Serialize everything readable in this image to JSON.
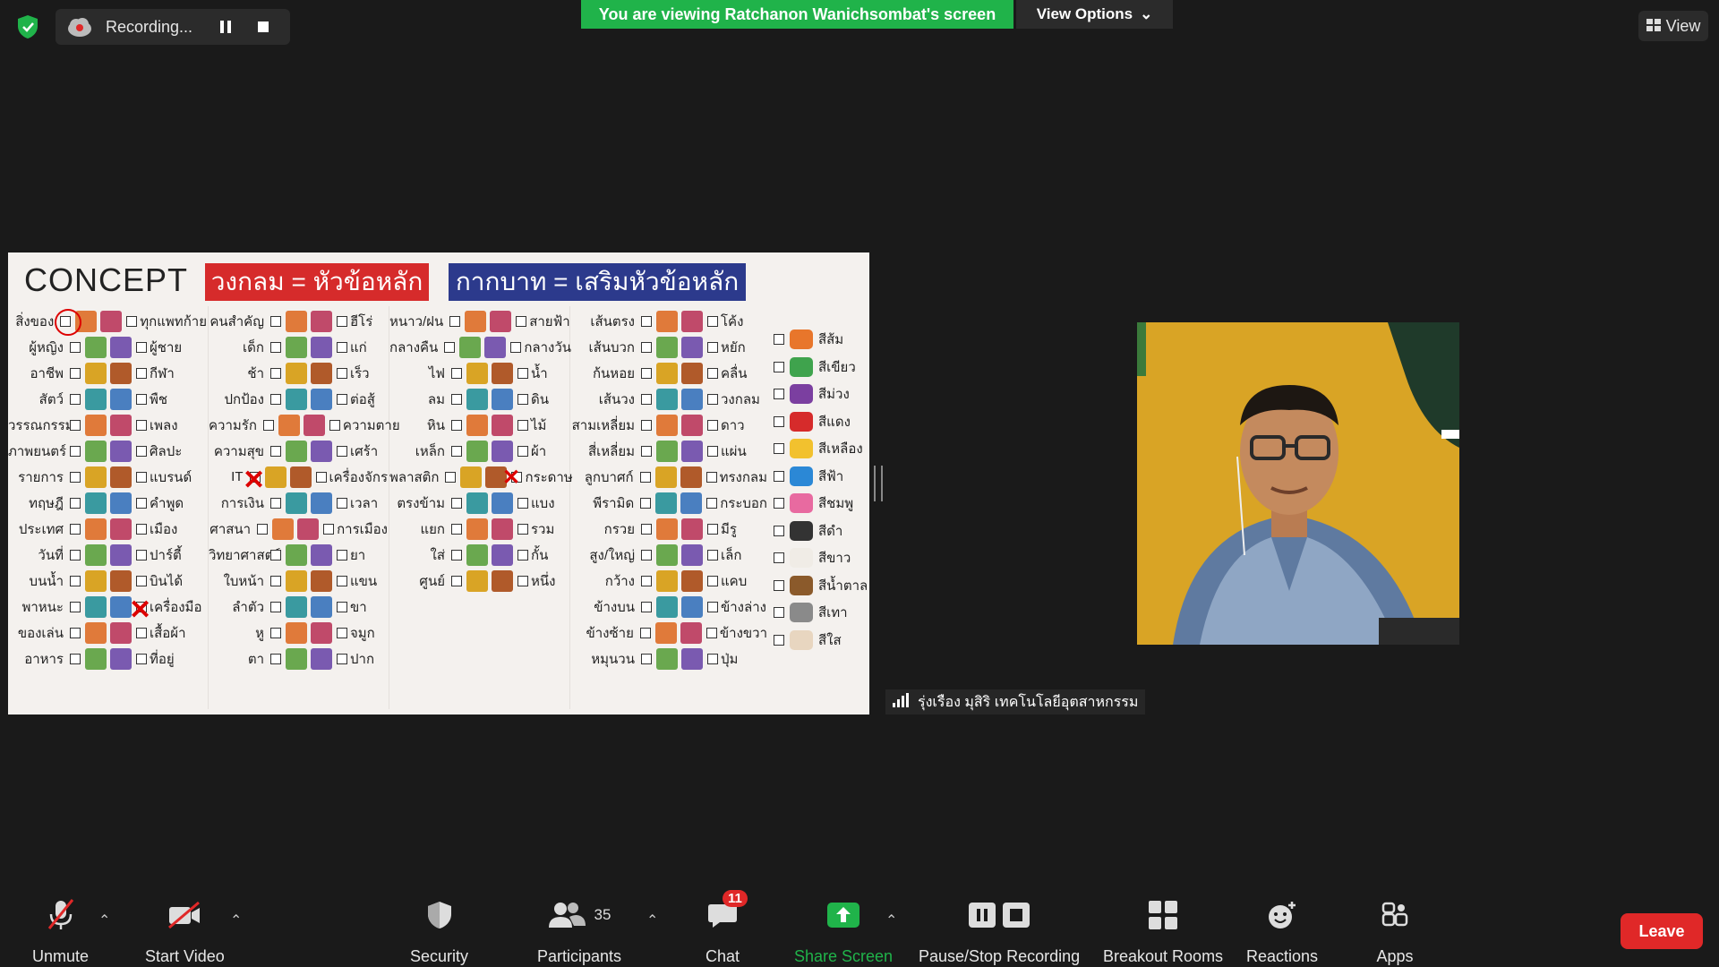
{
  "topbar": {
    "recording_label": "Recording...",
    "viewing_banner": "You are viewing Ratchanon Wanichsombat's screen",
    "view_options_label": "View Options",
    "view_label": "View"
  },
  "shared_screen": {
    "title": "CONCEPT",
    "header_red": "วงกลม = หัวข้อหลัก",
    "header_blue": "กากบาท = เสริมหัวข้อหลัก",
    "col1": [
      {
        "label": "สิ่งของ",
        "right": "ทุกแพทก้าย"
      },
      {
        "label": "ผู้หญิง",
        "right": "ผู้ชาย"
      },
      {
        "label": "อาชีพ",
        "right": "กีฬา"
      },
      {
        "label": "สัตว์",
        "right": "พืช"
      },
      {
        "label": "วรรณกรรม",
        "right": "เพลง"
      },
      {
        "label": "ภาพยนตร์",
        "right": "ศิลปะ"
      },
      {
        "label": "รายการ",
        "right": "แบรนด์"
      },
      {
        "label": "ทฤษฎี",
        "right": "คำพูด"
      },
      {
        "label": "ประเทศ",
        "right": "เมือง"
      },
      {
        "label": "วันที่",
        "right": "ปาร์ตี้"
      },
      {
        "label": "บนน้ำ",
        "right": "บินได้"
      },
      {
        "label": "พาหนะ",
        "right": "เครื่องมือ"
      },
      {
        "label": "ของเล่น",
        "right": "เสื้อผ้า"
      },
      {
        "label": "อาหาร",
        "right": "ที่อยู่"
      }
    ],
    "col2": [
      {
        "label": "คนสำคัญ",
        "right": "ฮีโร่"
      },
      {
        "label": "เด็ก",
        "right": "แก่"
      },
      {
        "label": "ช้า",
        "right": "เร็ว"
      },
      {
        "label": "ปกป้อง",
        "right": "ต่อสู้"
      },
      {
        "label": "ความรัก",
        "right": "ความตาย"
      },
      {
        "label": "ความสุข",
        "right": "เศร้า"
      },
      {
        "label": "IT",
        "right": "เครื่องจักร"
      },
      {
        "label": "การเงิน",
        "right": "เวลา"
      },
      {
        "label": "ศาสนา",
        "right": "การเมือง"
      },
      {
        "label": "วิทยาศาสตร์",
        "right": "ยา"
      },
      {
        "label": "ใบหน้า",
        "right": "แขน"
      },
      {
        "label": "ลำตัว",
        "right": "ขา"
      },
      {
        "label": "หู",
        "right": "จมูก"
      },
      {
        "label": "ตา",
        "right": "ปาก"
      }
    ],
    "col3": [
      {
        "label": "หนาว/ฝน",
        "right": "สายฟ้า"
      },
      {
        "label": "กลางคืน",
        "right": "กลางวัน"
      },
      {
        "label": "ไฟ",
        "right": "น้ำ"
      },
      {
        "label": "ลม",
        "right": "ดิน"
      },
      {
        "label": "หิน",
        "right": "ไม้"
      },
      {
        "label": "เหล็ก",
        "right": "ผ้า"
      },
      {
        "label": "พลาสติก",
        "right": "กระดาษ"
      },
      {
        "label": "ตรงข้าม",
        "right": "แบง"
      },
      {
        "label": "แยก",
        "right": "รวม"
      },
      {
        "label": "ใส่",
        "right": "กั้น"
      },
      {
        "label": "ศูนย์",
        "right": "หนึ่ง"
      }
    ],
    "col4": [
      {
        "label": "เส้นตรง",
        "right": "โค้ง"
      },
      {
        "label": "เส้นบวก",
        "right": "หยัก"
      },
      {
        "label": "ก้นหอย",
        "right": "คลื่น"
      },
      {
        "label": "เส้นวง",
        "right": "วงกลม"
      },
      {
        "label": "สามเหลี่ยม",
        "right": "ดาว"
      },
      {
        "label": "สี่เหลี่ยม",
        "right": "แผ่น"
      },
      {
        "label": "ลูกบาศก์",
        "right": "ทรงกลม"
      },
      {
        "label": "พีรามิด",
        "right": "กระบอก"
      },
      {
        "label": "กรวย",
        "right": "มีรู"
      },
      {
        "label": "สูง/ใหญ่",
        "right": "เล็ก"
      },
      {
        "label": "กว้าง",
        "right": "แคบ"
      },
      {
        "label": "ข้างบน",
        "right": "ข้างล่าง"
      },
      {
        "label": "ข้างซ้าย",
        "right": "ข้างขวา"
      },
      {
        "label": "หมุนวน",
        "right": "ปุ่ม"
      }
    ],
    "colors": [
      {
        "label": "สีส้ม",
        "color": "#e8762b"
      },
      {
        "label": "สีเขียว",
        "color": "#3fa34d"
      },
      {
        "label": "สีม่วง",
        "color": "#7b3fa0"
      },
      {
        "label": "สีแดง",
        "color": "#d62b2b"
      },
      {
        "label": "สีเหลือง",
        "color": "#f2c12e"
      },
      {
        "label": "สีฟ้า",
        "color": "#2b88d6"
      },
      {
        "label": "สีชมพู",
        "color": "#e86aa0"
      },
      {
        "label": "สีดำ",
        "color": "#333333"
      },
      {
        "label": "สีขาว",
        "color": "#f0ece6"
      },
      {
        "label": "สีน้ำตาล",
        "color": "#8b5a2b"
      },
      {
        "label": "สีเทา",
        "color": "#8a8a8a"
      },
      {
        "label": "สีใส",
        "color": "#e8d6c0"
      }
    ]
  },
  "participant": {
    "name": "รุ่งเรือง มุสิริ เทคโนโลยีอุตสาหกรรม"
  },
  "toolbar": {
    "unmute": "Unmute",
    "start_video": "Start Video",
    "security": "Security",
    "participants": "Participants",
    "participant_count": "35",
    "chat": "Chat",
    "chat_badge": "11",
    "share_screen": "Share Screen",
    "pause_stop_recording": "Pause/Stop Recording",
    "breakout_rooms": "Breakout Rooms",
    "reactions": "Reactions",
    "apps": "Apps",
    "leave": "Leave"
  },
  "colors": {
    "accent_green": "#20b34a",
    "leave_red": "#e02828",
    "background": "#1a1a1a"
  }
}
